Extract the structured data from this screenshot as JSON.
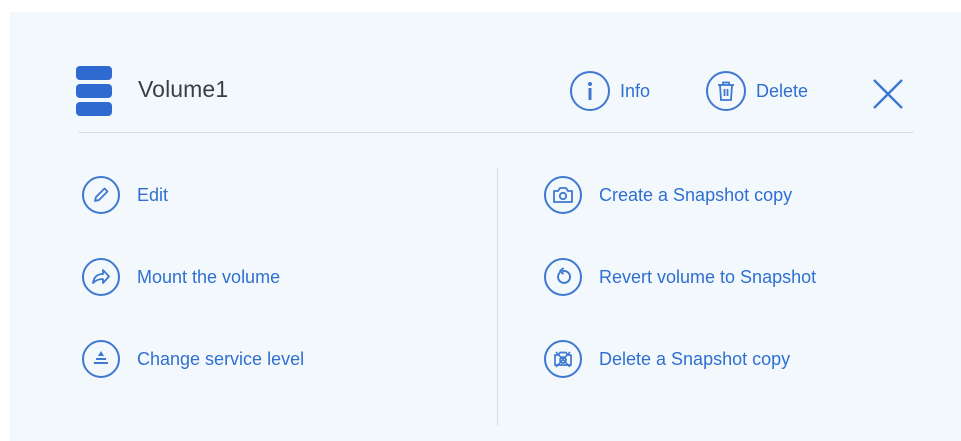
{
  "header": {
    "title": "Volume1",
    "info_label": "Info",
    "delete_label": "Delete",
    "icons": {
      "volume": "database-icon",
      "info": "info-icon",
      "delete": "trash-icon",
      "close": "close-icon"
    }
  },
  "actions": {
    "left": [
      {
        "label": "Edit",
        "icon": "pencil-icon"
      },
      {
        "label": "Mount the volume",
        "icon": "share-arrow-icon"
      },
      {
        "label": "Change service level",
        "icon": "service-level-icon"
      }
    ],
    "right": [
      {
        "label": "Create a Snapshot copy",
        "icon": "camera-icon"
      },
      {
        "label": "Revert volume to Snapshot",
        "icon": "revert-icon"
      },
      {
        "label": "Delete a Snapshot copy",
        "icon": "delete-snapshot-icon"
      }
    ]
  },
  "colors": {
    "accent": "#2f6fd1",
    "icon_fill": "#2f6ad0",
    "panel_background": "#f3f8fc",
    "title_text": "#3a3f45",
    "divider": "#d6dde5"
  }
}
